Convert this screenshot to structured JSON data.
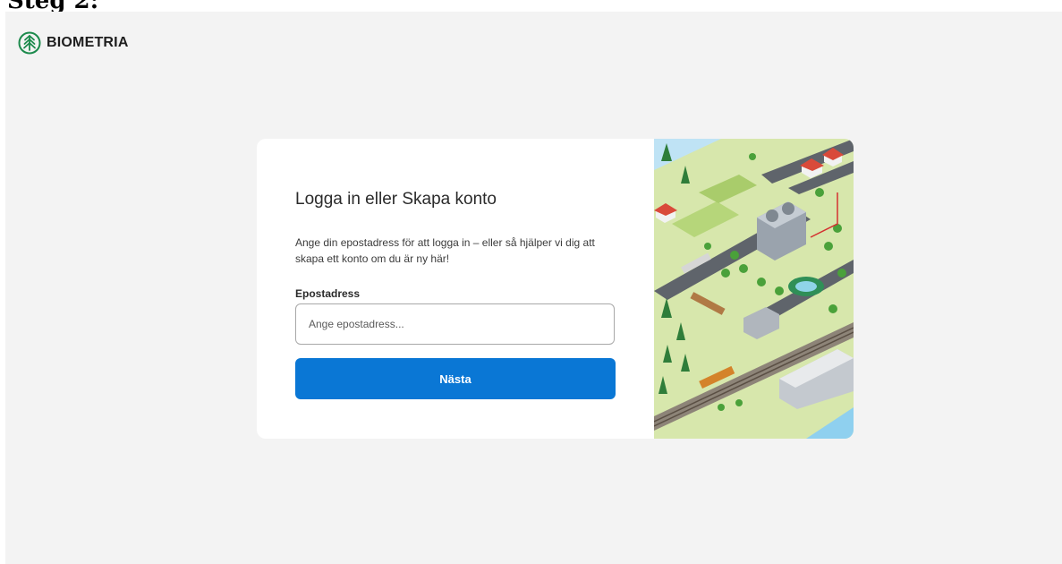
{
  "document": {
    "heading": "Steg 2:"
  },
  "brand": {
    "name": "BIOMETRIA",
    "logo_icon": "biometria-tree-logo-icon"
  },
  "login": {
    "title": "Logga in eller Skapa konto",
    "description": "Ange din epostadress för att logga in – eller så hjälper vi dig att skapa ett konto om du är ny här!",
    "email_label": "Epostadress",
    "email_placeholder": "Ange epostadress...",
    "email_value": "",
    "next_label": "Nästa"
  },
  "colors": {
    "page_background": "#f3f3f3",
    "card_background": "#ffffff",
    "primary_button": "#0a77d5",
    "brand_green": "#1c8a4c"
  }
}
